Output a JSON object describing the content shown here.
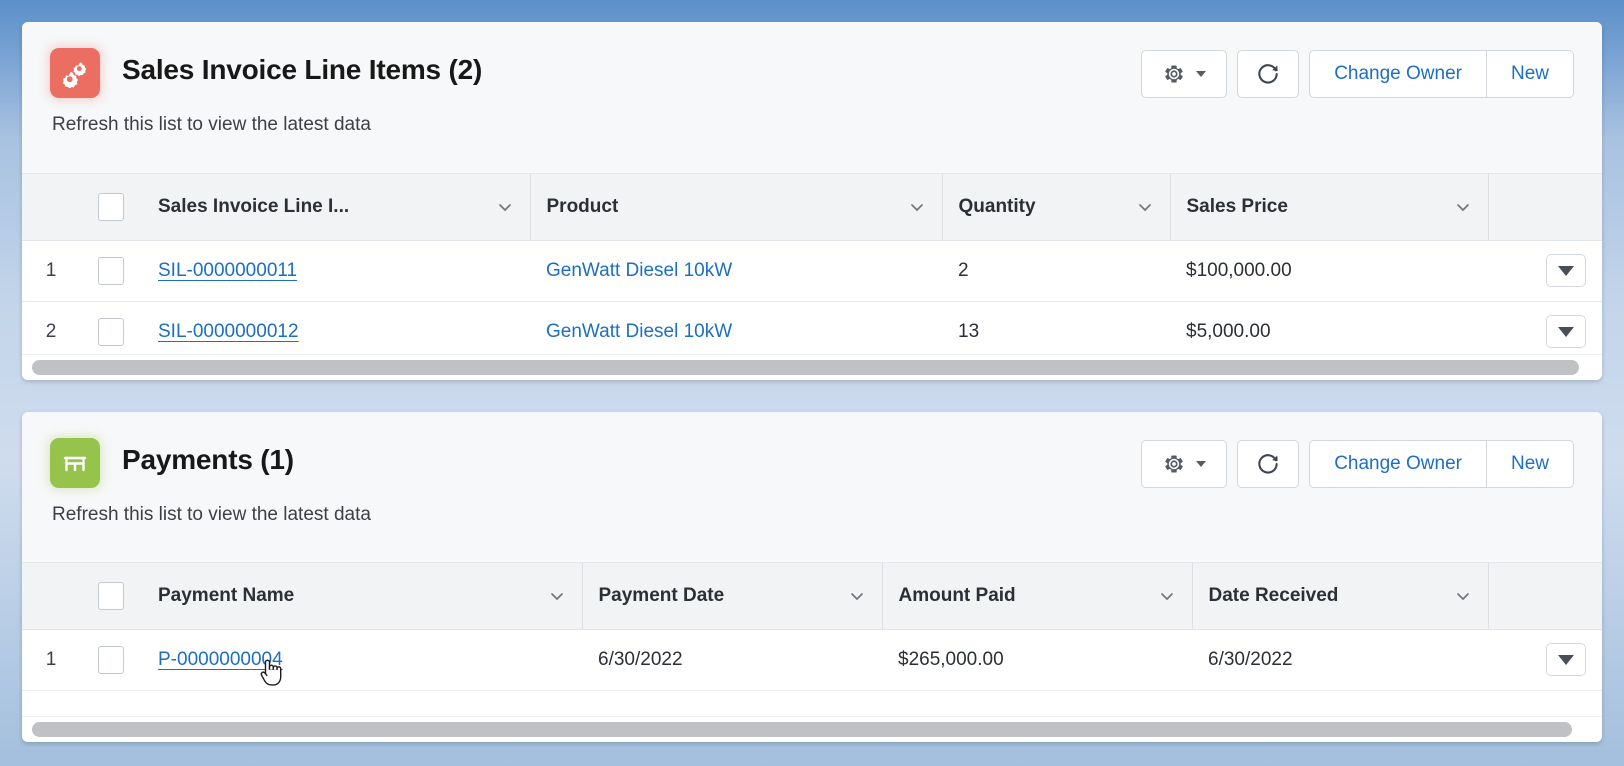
{
  "page": {
    "background_top": "#5b8fc9",
    "background_bottom": "#a3bfdd"
  },
  "cards": [
    {
      "id": "sales-invoice-line-items",
      "icon": {
        "name": "product-item-icon",
        "color": "#ec6e62"
      },
      "title": "Sales Invoice Line Items (2)",
      "subtitle": "Refresh this list to view the latest data",
      "actions": {
        "gear_label": "",
        "refresh_label": "",
        "change_owner_label": "Change Owner",
        "new_label": "New"
      },
      "table": {
        "columns": [
          {
            "label": "Sales Invoice Line I...",
            "sortable": true
          },
          {
            "label": "Product",
            "sortable": true
          },
          {
            "label": "Quantity",
            "sortable": true
          },
          {
            "label": "Sales Price",
            "sortable": true
          }
        ],
        "rows": [
          {
            "num": "1",
            "name": "SIL-0000000011",
            "product": "GenWatt Diesel 10kW",
            "quantity": "2",
            "sales_price": "$100,000.00"
          },
          {
            "num": "2",
            "name": "SIL-0000000012",
            "product": "GenWatt Diesel 10kW",
            "quantity": "13",
            "sales_price": "$5,000.00"
          }
        ]
      }
    },
    {
      "id": "payments",
      "icon": {
        "name": "bank-icon",
        "color": "#96c34c"
      },
      "title": "Payments (1)",
      "subtitle": "Refresh this list to view the latest data",
      "actions": {
        "gear_label": "",
        "refresh_label": "",
        "change_owner_label": "Change Owner",
        "new_label": "New"
      },
      "table": {
        "columns": [
          {
            "label": "Payment Name",
            "sortable": true
          },
          {
            "label": "Payment Date",
            "sortable": true
          },
          {
            "label": "Amount Paid",
            "sortable": true
          },
          {
            "label": "Date Received",
            "sortable": true
          }
        ],
        "rows": [
          {
            "num": "1",
            "name": "P-0000000004",
            "payment_date": "6/30/2022",
            "amount_paid": "$265,000.00",
            "date_received": "6/30/2022"
          }
        ]
      }
    }
  ],
  "colors": {
    "link": "#1d6fc1",
    "header_bg": "#f2f3f4",
    "card_head_bg": "#f7f8f9",
    "scrollbar_thumb": "#bfc1c4"
  }
}
